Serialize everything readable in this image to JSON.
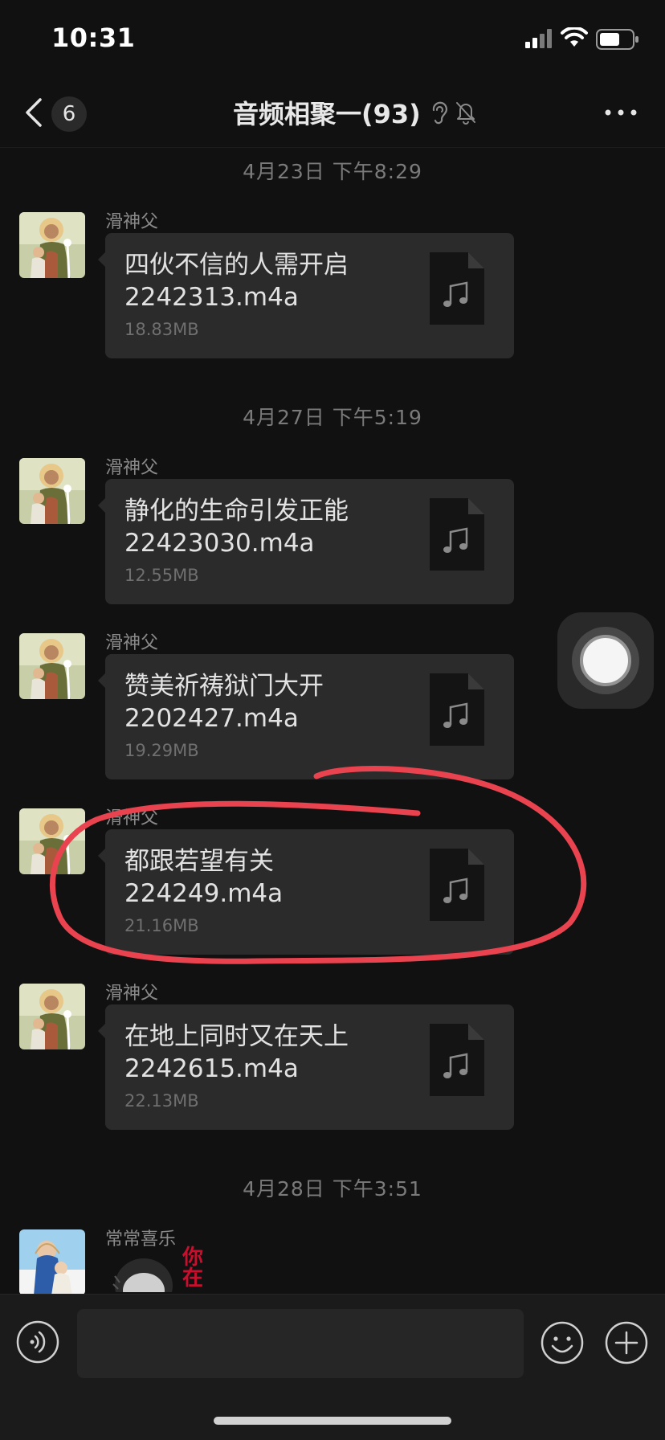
{
  "status_bar": {
    "time": "10:31"
  },
  "nav": {
    "back_count": "6",
    "title": "音频相聚一(93)"
  },
  "messages": [
    {
      "timestamp": "4月23日 下午8:29",
      "sender": "滑神父",
      "file_name": "四伙不信的人需开启\n2242313.m4a",
      "file_size": "18.83MB"
    },
    {
      "timestamp": "4月27日 下午5:19",
      "sender": "滑神父",
      "file_name": "静化的生命引发正能\n22423030.m4a",
      "file_size": "12.55MB"
    },
    {
      "sender": "滑神父",
      "file_name": "赞美祈祷狱门大开\n2202427.m4a",
      "file_size": "19.29MB"
    },
    {
      "sender": "滑神父",
      "file_name": "都跟若望有关\n224249.m4a",
      "file_size": "21.16MB"
    },
    {
      "sender": "滑神父",
      "file_name": "在地上同时又在天上\n2242615.m4a",
      "file_size": "22.13MB"
    },
    {
      "timestamp": "4月28日 下午3:51",
      "sender": "常常喜乐"
    }
  ],
  "sticker_text": "你在",
  "icons": {
    "back": "chevron-left-icon",
    "ear": "ear-icon",
    "mute": "bell-slash-icon",
    "more": "ellipsis-icon",
    "file": "music-file-icon",
    "voice": "voice-icon",
    "emoji": "emoji-icon",
    "plus": "plus-icon"
  },
  "colors": {
    "background": "#111111",
    "bubble": "#2b2b2b",
    "annotation": "#e8434f"
  }
}
